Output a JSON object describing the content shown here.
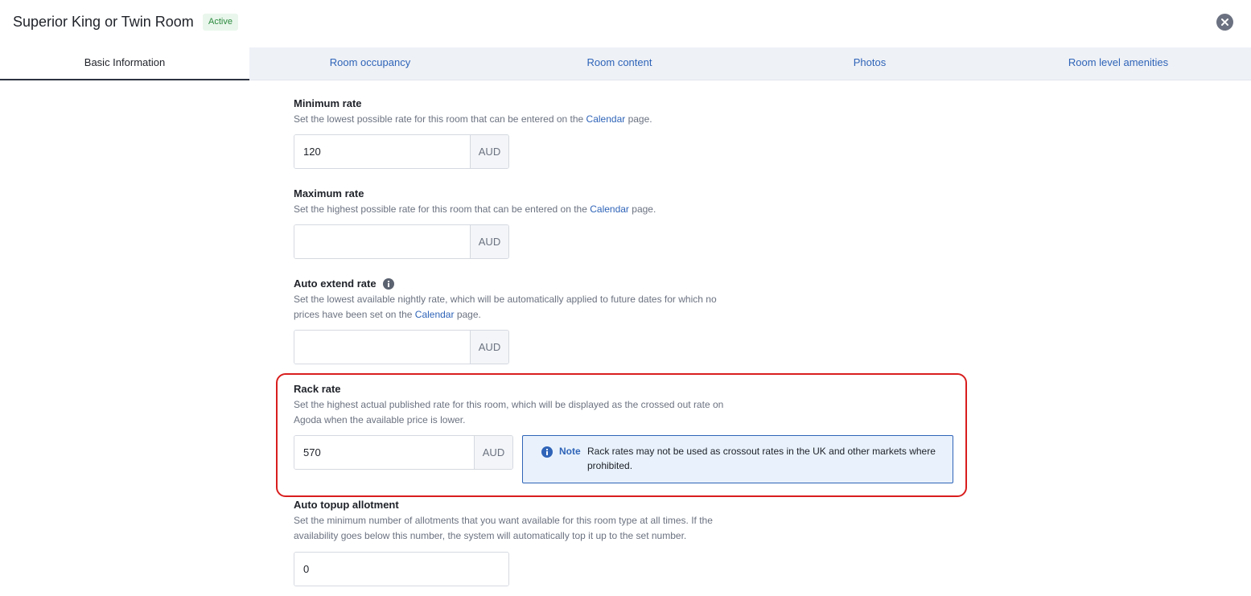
{
  "header": {
    "title": "Superior King or Twin Room",
    "status": "Active"
  },
  "tabs": [
    {
      "label": "Basic Information",
      "active": true
    },
    {
      "label": "Room occupancy",
      "active": false
    },
    {
      "label": "Room content",
      "active": false
    },
    {
      "label": "Photos",
      "active": false
    },
    {
      "label": "Room level amenities",
      "active": false
    }
  ],
  "fields": {
    "minimum_rate": {
      "label": "Minimum rate",
      "desc_before": "Set the lowest possible rate for this room that can be entered on the ",
      "desc_link": "Calendar",
      "desc_after": " page.",
      "value": "120",
      "currency": "AUD"
    },
    "maximum_rate": {
      "label": "Maximum rate",
      "desc_before": "Set the highest possible rate for this room that can be entered on the ",
      "desc_link": "Calendar",
      "desc_after": " page.",
      "value": "",
      "currency": "AUD"
    },
    "auto_extend_rate": {
      "label": "Auto extend rate",
      "desc_line1": "Set the lowest available nightly rate, which will be automatically applied to future dates for which no",
      "desc_before": "prices have been set on the ",
      "desc_link": "Calendar",
      "desc_after": " page.",
      "value": "",
      "currency": "AUD"
    },
    "rack_rate": {
      "label": "Rack rate",
      "desc_line1": "Set the highest actual published rate for this room, which will be displayed as the crossed out rate on",
      "desc_line2": "Agoda when the available price is lower.",
      "value": "570",
      "currency": "AUD",
      "note_label": "Note",
      "note_text": "Rack rates may not be used as crossout rates in the UK and other markets where prohibited."
    },
    "auto_topup_allotment": {
      "label": "Auto topup allotment",
      "desc_line1": "Set the minimum number of allotments that you want available for this room type at all times. If the",
      "desc_line2": "availability goes below this number, the system will automatically top it up to the set number.",
      "value": "0"
    }
  },
  "colors": {
    "accent": "#2f64b8",
    "highlight": "#d91e1e",
    "status_green": "#2b8a3e"
  },
  "icons": [
    "close-icon",
    "info-icon",
    "note-info-icon"
  ]
}
